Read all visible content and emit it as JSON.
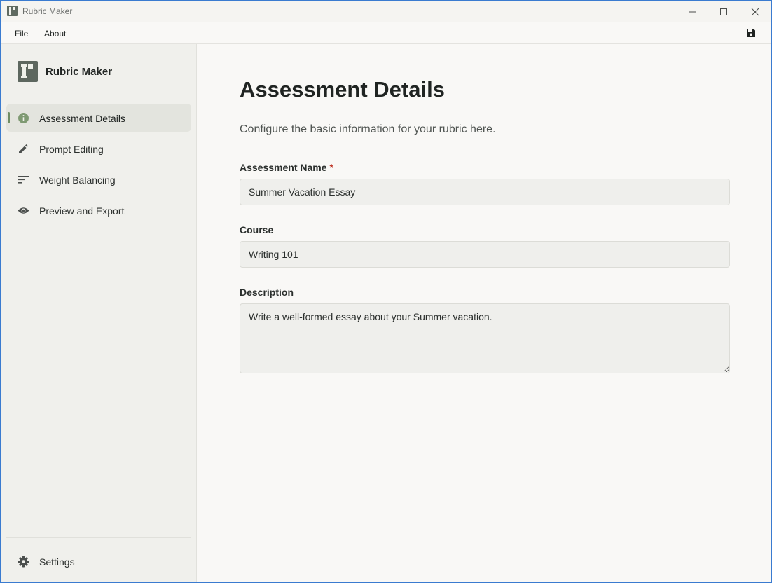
{
  "window": {
    "title": "Rubric Maker"
  },
  "menubar": {
    "items": [
      {
        "label": "File"
      },
      {
        "label": "About"
      }
    ],
    "save_icon": "save-icon"
  },
  "sidebar": {
    "brand_name": "Rubric Maker",
    "items": [
      {
        "label": "Assessment Details",
        "icon": "info-icon",
        "active": true
      },
      {
        "label": "Prompt Editing",
        "icon": "pencil-icon",
        "active": false
      },
      {
        "label": "Weight Balancing",
        "icon": "sort-lines-icon",
        "active": false
      },
      {
        "label": "Preview and Export",
        "icon": "eye-icon",
        "active": false
      }
    ],
    "settings_label": "Settings"
  },
  "main": {
    "title": "Assessment Details",
    "subtitle": "Configure the basic information for your rubric here.",
    "fields": {
      "assessment_name": {
        "label": "Assessment Name",
        "required_mark": "*",
        "value": "Summer Vacation Essay"
      },
      "course": {
        "label": "Course",
        "value": "Writing 101"
      },
      "description": {
        "label": "Description",
        "value": "Write a well-formed essay about your Summer vacation."
      }
    }
  },
  "colors": {
    "accent": "#6f8c63",
    "required": "#c0392b",
    "sidebar_bg": "#f0f0ec",
    "main_bg": "#f9f8f6"
  }
}
